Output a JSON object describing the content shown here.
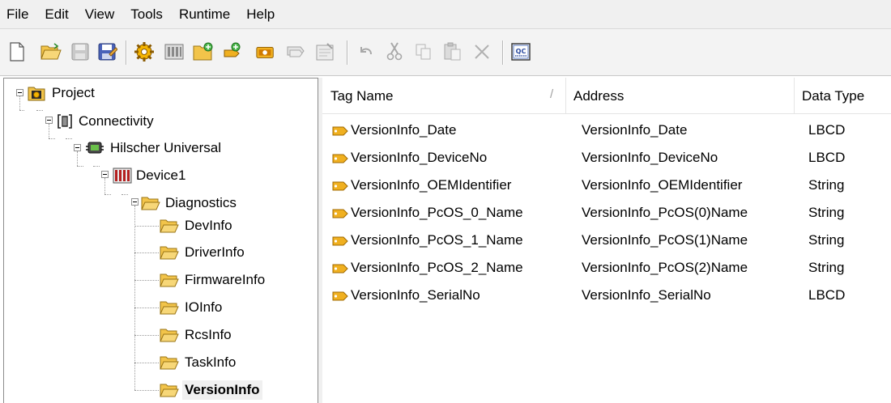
{
  "menu": [
    "File",
    "Edit",
    "View",
    "Tools",
    "Runtime",
    "Help"
  ],
  "tree": {
    "project": "Project",
    "connectivity": "Connectivity",
    "channel": "Hilscher Universal",
    "device": "Device1",
    "group": "Diagnostics",
    "children": [
      "DevInfo",
      "DriverInfo",
      "FirmwareInfo",
      "IOInfo",
      "RcsInfo",
      "TaskInfo",
      "VersionInfo"
    ],
    "selected": "VersionInfo"
  },
  "list": {
    "columns": [
      "Tag Name",
      "Address",
      "Data Type"
    ],
    "sort_indicator": "/",
    "rows": [
      {
        "name": "VersionInfo_Date",
        "address": "VersionInfo_Date",
        "type": "LBCD"
      },
      {
        "name": "VersionInfo_DeviceNo",
        "address": "VersionInfo_DeviceNo",
        "type": "LBCD"
      },
      {
        "name": "VersionInfo_OEMIdentifier",
        "address": "VersionInfo_OEMIdentifier",
        "type": "String"
      },
      {
        "name": "VersionInfo_PcOS_0_Name",
        "address": "VersionInfo_PcOS(0)Name",
        "type": "String"
      },
      {
        "name": "VersionInfo_PcOS_1_Name",
        "address": "VersionInfo_PcOS(1)Name",
        "type": "String"
      },
      {
        "name": "VersionInfo_PcOS_2_Name",
        "address": "VersionInfo_PcOS(2)Name",
        "type": "String"
      },
      {
        "name": "VersionInfo_SerialNo",
        "address": "VersionInfo_SerialNo",
        "type": "LBCD"
      }
    ]
  },
  "toolbar": {
    "icons": [
      "new-file-icon",
      "open-folder-icon",
      "save-icon",
      "save-as-icon",
      "new-channel-icon",
      "new-device-icon",
      "new-tag-group-icon",
      "new-tag-icon",
      "bulk-tag-icon",
      "duplicate-tag-icon",
      "properties-icon",
      "undo-icon",
      "cut-icon",
      "copy-icon",
      "paste-icon",
      "delete-icon",
      "quick-client-icon"
    ],
    "qc_label": "QC"
  },
  "colors": {
    "folder": "#f0c040",
    "tag": "#e9a200",
    "selection": "#f0f0f0"
  }
}
